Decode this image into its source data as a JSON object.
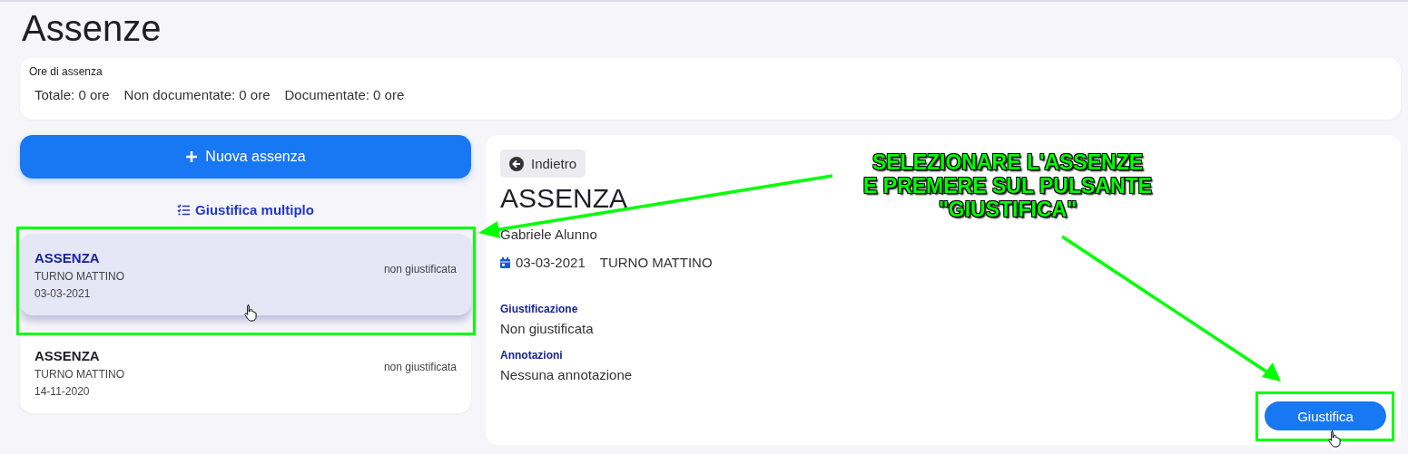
{
  "page_title": "Assenze",
  "summary": {
    "label": "Ore di assenza",
    "items": [
      {
        "label": "Totale:",
        "value": "0 ore"
      },
      {
        "label": "Non documentate:",
        "value": "0 ore"
      },
      {
        "label": "Documentate:",
        "value": "0 ore"
      }
    ]
  },
  "new_button": {
    "label": "Nuova assenza"
  },
  "multi_link": {
    "label": "Giustifica multiplo"
  },
  "absences": [
    {
      "title": "ASSENZA",
      "shift": "TURNO MATTINO",
      "date": "03-03-2021",
      "status": "non giustificata",
      "selected": true
    },
    {
      "title": "ASSENZA",
      "shift": "TURNO MATTINO",
      "date": "14-11-2020",
      "status": "non giustificata",
      "selected": false
    }
  ],
  "detail": {
    "back": "Indietro",
    "title": "ASSENZA",
    "student": "Gabriele Alunno",
    "date": "03-03-2021",
    "shift": "TURNO MATTINO",
    "sections": [
      {
        "label": "Giustificazione",
        "value": "Non giustificata"
      },
      {
        "label": "Annotazioni",
        "value": "Nessuna annotazione"
      }
    ],
    "button": "Giustifica"
  },
  "annotation": {
    "lines": [
      "SELEZIONARE L'ASSENZE",
      "E PREMERE SUL PULSANTE",
      "\"GIUSTIFICA\""
    ]
  }
}
